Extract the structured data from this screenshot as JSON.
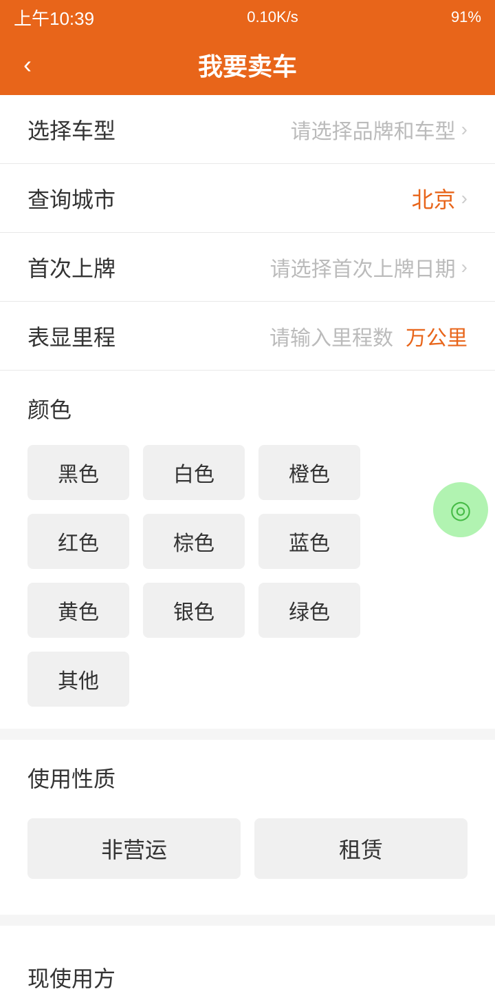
{
  "statusBar": {
    "time": "上午10:39",
    "network": "0.10K/s",
    "battery": "91%"
  },
  "header": {
    "back": "‹",
    "title": "我要卖车"
  },
  "form": {
    "rows": [
      {
        "id": "car-type",
        "label": "选择车型",
        "placeholder": "请选择品牌和车型",
        "value": "",
        "isCity": false
      },
      {
        "id": "city",
        "label": "查询城市",
        "placeholder": "",
        "value": "北京",
        "isCity": true
      },
      {
        "id": "first-reg",
        "label": "首次上牌",
        "placeholder": "请选择首次上牌日期",
        "value": "",
        "isCity": false
      },
      {
        "id": "mileage",
        "label": "表显里程",
        "placeholder": "请输入里程数",
        "unit": "万公里",
        "value": "",
        "isCity": false
      }
    ]
  },
  "colorSection": {
    "title": "颜色",
    "colors": [
      "黑色",
      "白色",
      "橙色",
      "红色",
      "棕色",
      "蓝色",
      "黄色",
      "银色",
      "绿色",
      "其他"
    ]
  },
  "usageSection": {
    "title": "使用性质",
    "buttons": [
      "非营运",
      "租赁"
    ]
  },
  "ownerSection": {
    "title": "现使用方"
  }
}
